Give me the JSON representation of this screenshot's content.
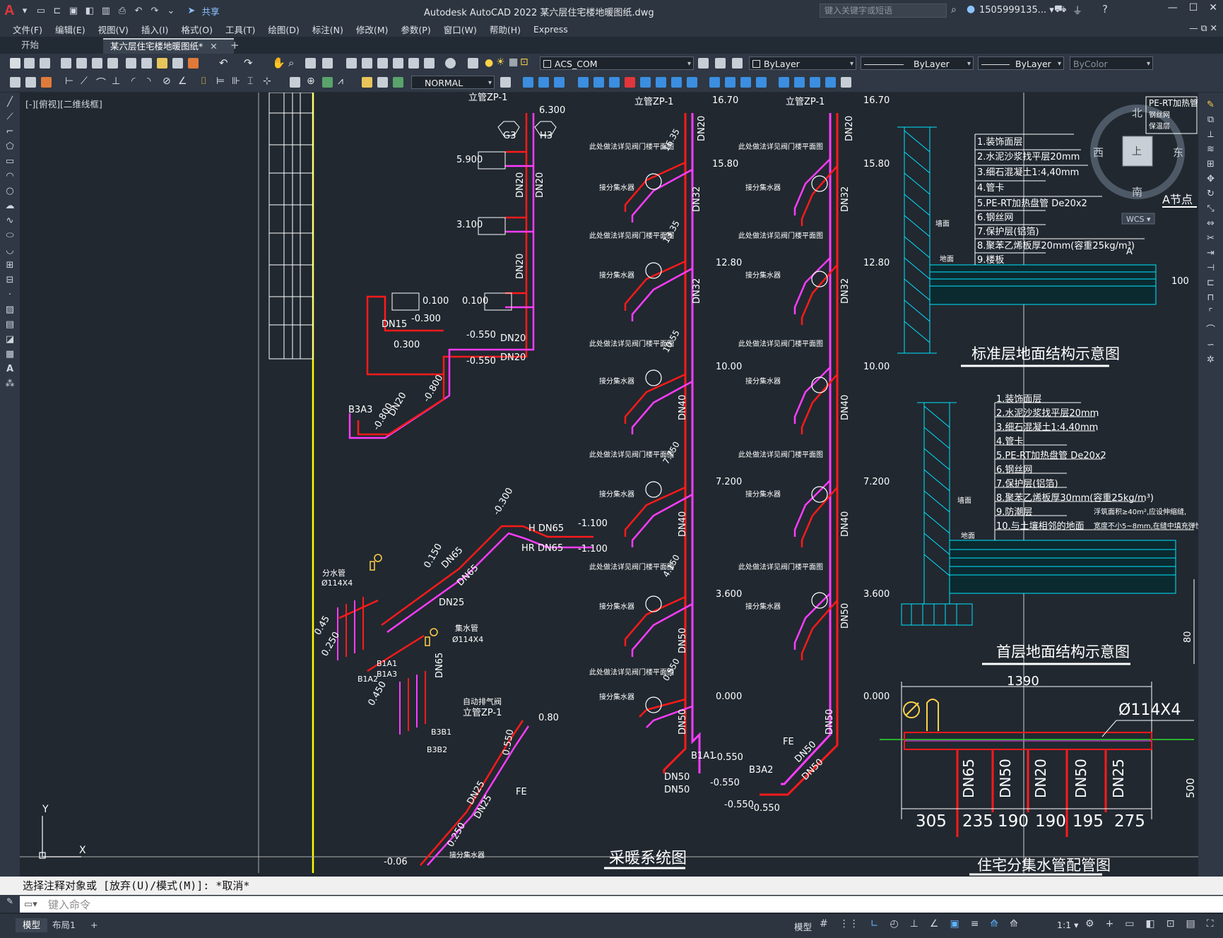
{
  "window": {
    "title": "Autodesk AutoCAD 2022    某六层住宅楼地暖图纸.dwg",
    "search_placeholder": "键入关键字或短语",
    "user": "1505999135...",
    "share": "共享",
    "app_logo": "A"
  },
  "menu": [
    "文件(F)",
    "编辑(E)",
    "视图(V)",
    "插入(I)",
    "格式(O)",
    "工具(T)",
    "绘图(D)",
    "标注(N)",
    "修改(M)",
    "参数(P)",
    "窗口(W)",
    "帮助(H)",
    "Express"
  ],
  "tabs": {
    "start": "开始",
    "active": "某六层住宅楼地暖图纸*"
  },
  "toolbar": {
    "layer": "ACS_COM",
    "color": "ByLayer",
    "linetype": "ByLayer",
    "lineweight": "ByLayer",
    "plotstyle": "ByColor",
    "dimstyle": "NORMAL"
  },
  "viewport_label": "[-][俯视][二维线框]",
  "drawing": {
    "title_heating": "采暖系统图",
    "title_std_floor": "标准层地面结构示意图",
    "title_first_floor": "首层地面结构示意图",
    "title_manifold": "住宅分集水管配管图",
    "node_label": "A节点",
    "node_marker": "A",
    "dim_100": "100",
    "dim_80": "80",
    "dim_500": "500",
    "dim_1390": "1390",
    "phi_label": "Ø114X4",
    "manifold_pipes": [
      "DN65",
      "DN50",
      "DN20",
      "DN50",
      "DN25"
    ],
    "manifold_dims": [
      "305",
      "235",
      "190",
      "190",
      "195",
      "275"
    ],
    "std_layers": [
      "1.装饰面层",
      "2.水泥沙浆找平层20mm",
      "3.细石混凝土1:4,40mm",
      "4.管卡",
      "5.PE-RT加热盘管 De20x2",
      "6.钢丝网",
      "7.保护层(铝箔)",
      "8.聚苯乙烯板厚20mm(容重25kg/m³)",
      "9.楼板"
    ],
    "first_layers": [
      "1.装饰面层",
      "2.水泥沙浆找平层20mm",
      "3.细石混凝土1:4,40mm",
      "4.管卡",
      "5.PE-RT加热盘管 De20x2",
      "6.钢丝网",
      "7.保护层(铝箔)",
      "8.聚苯乙烯板厚30mm(容重25kg/m³)",
      "9.防潮层",
      "10.与土壤相邻的地面"
    ],
    "first_note1": "浮筑面积≥40m²,应设伸缩缝,",
    "first_note2": "宽度不小5~8mm,在缝中填充弹性膨胀材",
    "pe_rt_legend": [
      "PE-RT加热管",
      "钢丝网",
      "保温层"
    ],
    "wall_label": "墙面",
    "floor_label": "地面",
    "riser_left": {
      "top_label": "立管ZP-1",
      "pipes_mag": [
        "DN20",
        "DN32",
        "DN32",
        "DN40",
        "DN40",
        "DN50",
        "DN50"
      ],
      "levels": [
        "16.70",
        "15.80",
        "12.80",
        "10.00",
        "7.200",
        "3.600",
        "0.000"
      ],
      "bottom": [
        "DN50",
        "DN50",
        "B1A1",
        "-0.550",
        "-0.550"
      ]
    },
    "riser_right": {
      "top_label": "立管ZP-1",
      "pipes_mag": [
        "DN20",
        "DN32",
        "DN32",
        "DN40",
        "DN40",
        "DN50",
        "DN50"
      ],
      "levels": [
        "16.70",
        "15.80",
        "12.80",
        "10.00",
        "7.200",
        "3.600",
        "0.000"
      ],
      "bottom": [
        "FE",
        "B3A2",
        "DN50",
        "DN50",
        "-0.550",
        "-0.550"
      ]
    },
    "floor_notes": [
      "此处做法详见阀门楼平面图",
      "接分集水器"
    ],
    "floor_elevs": [
      "16.35",
      "13.35",
      "10.55",
      "7.750",
      "4.150",
      "0.550"
    ],
    "left_system": {
      "labels": [
        "立管ZP-1",
        "6.300",
        "G3",
        "H3",
        "5.900",
        "3.100",
        "DN20",
        "DN20",
        "DN20",
        "0.100",
        "0.100",
        "DN15",
        "-0.300",
        "0.300",
        "-0.550",
        "-0.550",
        "DN20",
        "DN20",
        "B3A3",
        "-0.800",
        "DN20",
        "-0.800"
      ],
      "lower": [
        "-0.300",
        "H DN65",
        "HR DN65",
        "-1.100",
        "-1.100",
        "0.150",
        "DN65",
        "DN65",
        "DN25",
        "分水管",
        "Ø114X4",
        "集水管",
        "Ø114X4",
        "0.45",
        "0.250",
        "0.450",
        "DN65",
        "B1A1",
        "B1A3",
        "B1A2",
        "B3B1",
        "B3B2",
        "自动排气阀",
        "立管ZP-1",
        "0.80",
        "0.550",
        "DN25",
        "DN25",
        "FE",
        "0.250",
        "-0.06",
        "接分集水器"
      ]
    }
  },
  "command": {
    "history": "选择注释对象或 [放弃(U)/模式(M)]: *取消*",
    "placeholder": "键入命令"
  },
  "status": {
    "tab_model": "模型",
    "tab_layout": "布局1",
    "model_btn": "模型",
    "scale": "1:1"
  },
  "colors": {
    "supply": "#ff1a1a",
    "return": "#ff3cff",
    "annotation": "#ffffff",
    "section": "#00e5ff",
    "grid_line": "#ffff00",
    "background": "#212830"
  }
}
